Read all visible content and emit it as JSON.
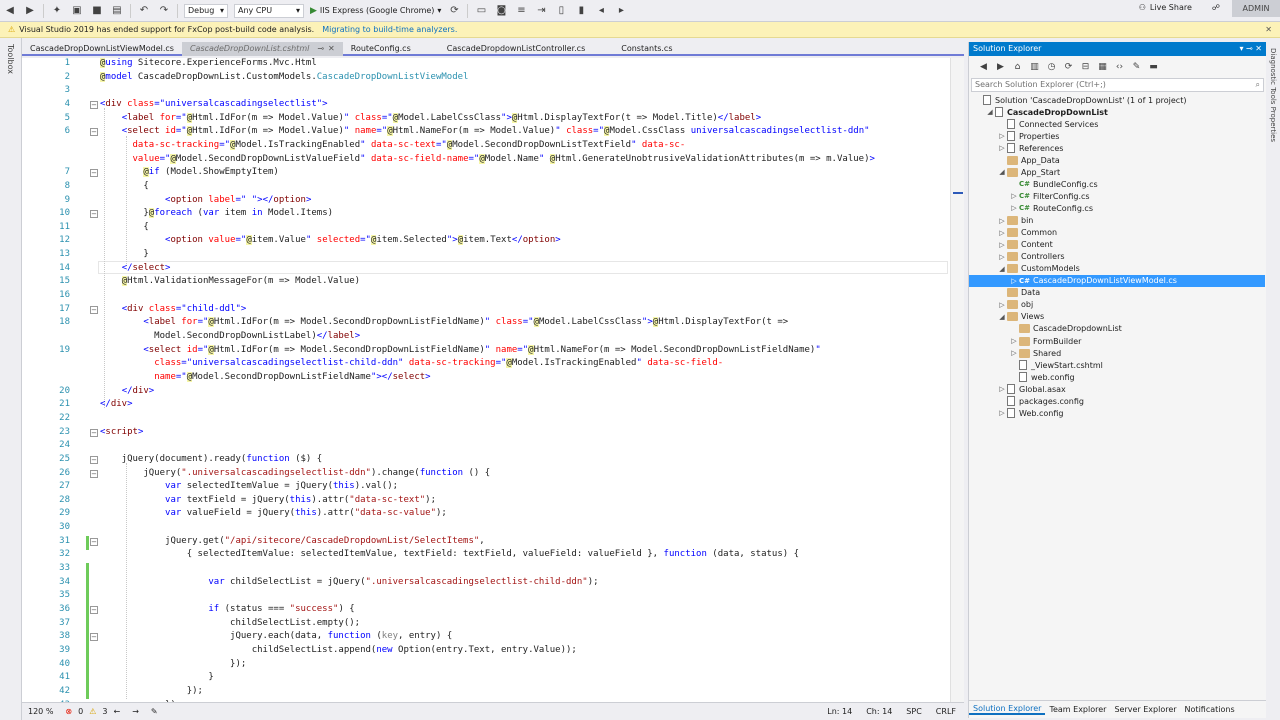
{
  "toolbar": {
    "config": "Debug",
    "platform": "Any CPU",
    "run_target": "IIS Express (Google Chrome)",
    "live_share": "Live Share",
    "user": "ADMIN"
  },
  "infobar": {
    "message": "Visual Studio 2019 has ended support for FxCop post-build code analysis.",
    "link": "Migrating to build-time analyzers."
  },
  "left_strip": "Toolbox",
  "tabs": [
    {
      "label": "CascadeDropDownListViewModel.cs"
    },
    {
      "label": "CascadeDropDownList.cshtml"
    },
    {
      "label": "RouteConfig.cs"
    },
    {
      "label": "CascadeDropdownListController.cs"
    },
    {
      "label": "Constants.cs"
    }
  ],
  "code_lines": [
    {
      "n": "1",
      "html": "<span class='at'>@</span><span class='k'>using</span> Sitecore.ExperienceForms.Mvc.Html"
    },
    {
      "n": "2",
      "html": "<span class='at'>@</span><span class='k'>model</span> CascadeDropDownList.CustomModels.<span class='t'>CascadeDropDownListViewModel</span>"
    },
    {
      "n": "3",
      "html": ""
    },
    {
      "n": "4",
      "html": "<span class='k'>&lt;</span><span class='m'>div</span> <span class='r'>class</span><span class='k'>=\"universalcascadingselectlist\"&gt;</span>"
    },
    {
      "n": "5",
      "html": "    <span class='k'>&lt;</span><span class='m'>label</span> <span class='r'>for</span><span class='k'>=\"</span><span class='at'>@</span>Html.IdFor(m =&gt; Model.Value)<span class='k'>\"</span> <span class='r'>class</span><span class='k'>=\"</span><span class='at'>@</span>Model.LabelCssClass<span class='k'>\"&gt;</span><span class='at'>@</span>Html.DisplayTextFor(t =&gt; Model.Title)<span class='k'>&lt;/</span><span class='m'>label</span><span class='k'>&gt;</span>"
    },
    {
      "n": "6",
      "html": "    <span class='k'>&lt;</span><span class='m'>select</span> <span class='r'>id</span><span class='k'>=\"</span><span class='at'>@</span>Html.IdFor(m =&gt; Model.Value)<span class='k'>\"</span> <span class='r'>name</span><span class='k'>=\"</span><span class='at'>@</span>Html.NameFor(m =&gt; Model.Value)<span class='k'>\"</span> <span class='r'>class</span><span class='k'>=\"</span><span class='at'>@</span>Model.CssClass <span class='k'>universalcascadingselectlist-ddn\"</span>"
    },
    {
      "n": "",
      "html": "      <span class='r'>data-sc-tracking</span><span class='k'>=\"</span><span class='at'>@</span>Model.IsTrackingEnabled<span class='k'>\"</span> <span class='r'>data-sc-text</span><span class='k'>=\"</span><span class='at'>@</span>Model.SecondDropDownListTextField<span class='k'>\"</span> <span class='r'>data-sc-</span>"
    },
    {
      "n": "",
      "html": "      <span class='r'>value</span><span class='k'>=\"</span><span class='at'>@</span>Model.SecondDropDownListValueField<span class='k'>\"</span> <span class='r'>data-sc-field-name</span><span class='k'>=\"</span><span class='at'>@</span>Model.Name<span class='k'>\"</span> <span class='at'>@</span>Html.GenerateUnobtrusiveValidationAttributes(m =&gt; m.Value)<span class='k'>&gt;</span>"
    },
    {
      "n": "7",
      "html": "        <span class='at'>@</span><span class='k'>if</span> (Model.ShowEmptyItem)"
    },
    {
      "n": "8",
      "html": "        {"
    },
    {
      "n": "9",
      "html": "            <span class='k'>&lt;</span><span class='m'>option</span> <span class='r'>label</span><span class='k'>=\" \"&gt;&lt;/</span><span class='m'>option</span><span class='k'>&gt;</span>"
    },
    {
      "n": "10",
      "html": "        }<span class='at'>@</span><span class='k'>foreach</span> (<span class='k'>var</span> item <span class='k'>in</span> Model.Items)"
    },
    {
      "n": "11",
      "html": "        {"
    },
    {
      "n": "12",
      "html": "            <span class='k'>&lt;</span><span class='m'>option</span> <span class='r'>value</span><span class='k'>=\"</span><span class='at'>@</span>item.Value<span class='k'>\"</span> <span class='r'>selected</span><span class='k'>=\"</span><span class='at'>@</span>item.Selected<span class='k'>\"&gt;</span><span class='at'>@</span>item.Text<span class='k'>&lt;/</span><span class='m'>option</span><span class='k'>&gt;</span>"
    },
    {
      "n": "13",
      "html": "        }"
    },
    {
      "n": "14",
      "html": "    <span class='k'>&lt;/</span><span class='m'>select</span><span class='k'>&gt;</span>"
    },
    {
      "n": "15",
      "html": "    <span class='at'>@</span>Html.ValidationMessageFor(m =&gt; Model.Value)"
    },
    {
      "n": "16",
      "html": ""
    },
    {
      "n": "17",
      "html": "    <span class='k'>&lt;</span><span class='m'>div</span> <span class='r'>class</span><span class='k'>=\"child-ddl\"&gt;</span>"
    },
    {
      "n": "18",
      "html": "        <span class='k'>&lt;</span><span class='m'>label</span> <span class='r'>for</span><span class='k'>=\"</span><span class='at'>@</span>Html.IdFor(m =&gt; Model.SecondDropDownListFieldName)<span class='k'>\"</span> <span class='r'>class</span><span class='k'>=\"</span><span class='at'>@</span>Model.LabelCssClass<span class='k'>\"&gt;</span><span class='at'>@</span>Html.DisplayTextFor(t =&gt;"
    },
    {
      "n": "",
      "html": "          Model.SecondDropDownListLabel)<span class='k'>&lt;/</span><span class='m'>label</span><span class='k'>&gt;</span>"
    },
    {
      "n": "19",
      "html": "        <span class='k'>&lt;</span><span class='m'>select</span> <span class='r'>id</span><span class='k'>=\"</span><span class='at'>@</span>Html.IdFor(m =&gt; Model.SecondDropDownListFieldName)<span class='k'>\"</span> <span class='r'>name</span><span class='k'>=\"</span><span class='at'>@</span>Html.NameFor(m =&gt; Model.SecondDropDownListFieldName)<span class='k'>\"</span>"
    },
    {
      "n": "",
      "html": "          <span class='r'>class</span><span class='k'>=\"universalcascadingselectlist-child-ddn\"</span> <span class='r'>data-sc-tracking</span><span class='k'>=\"</span><span class='at'>@</span>Model.IsTrackingEnabled<span class='k'>\"</span> <span class='r'>data-sc-field-</span>"
    },
    {
      "n": "",
      "html": "          <span class='r'>name</span><span class='k'>=\"</span><span class='at'>@</span>Model.SecondDropDownListFieldName<span class='k'>\"&gt;&lt;/</span><span class='m'>select</span><span class='k'>&gt;</span>"
    },
    {
      "n": "20",
      "html": "    <span class='k'>&lt;/</span><span class='m'>div</span><span class='k'>&gt;</span>"
    },
    {
      "n": "21",
      "html": "<span class='k'>&lt;/</span><span class='m'>div</span><span class='k'>&gt;</span>"
    },
    {
      "n": "22",
      "html": ""
    },
    {
      "n": "23",
      "html": "<span class='k'>&lt;</span><span class='m'>script</span><span class='k'>&gt;</span>"
    },
    {
      "n": "24",
      "html": ""
    },
    {
      "n": "25",
      "html": "    jQuery(document).ready(<span class='k'>function</span> ($) {"
    },
    {
      "n": "26",
      "html": "        jQuery(<span class='s'>\".universalcascadingselectlist-ddn\"</span>).change(<span class='k'>function</span> () {"
    },
    {
      "n": "27",
      "html": "            <span class='k'>var</span> selectedItemValue = jQuery(<span class='k'>this</span>).val();"
    },
    {
      "n": "28",
      "html": "            <span class='k'>var</span> textField = jQuery(<span class='k'>this</span>).attr(<span class='s'>\"data-sc-text\"</span>);"
    },
    {
      "n": "29",
      "html": "            <span class='k'>var</span> valueField = jQuery(<span class='k'>this</span>).attr(<span class='s'>\"data-sc-value\"</span>);"
    },
    {
      "n": "30",
      "html": ""
    },
    {
      "n": "31",
      "html": "            jQuery.get(<span class='s'>\"/api/sitecore/CascadeDropdownList/SelectItems\"</span>,"
    },
    {
      "n": "32",
      "html": "                { selectedItemValue: selectedItemValue, textField: textField, valueField: valueField }, <span class='k'>function</span> (data, status) {"
    },
    {
      "n": "33",
      "html": ""
    },
    {
      "n": "34",
      "html": "                    <span class='k'>var</span> childSelectList = jQuery(<span class='s'>\".universalcascadingselectlist-child-ddn\"</span>);"
    },
    {
      "n": "35",
      "html": ""
    },
    {
      "n": "36",
      "html": "                    <span class='k'>if</span> (status === <span class='s'>\"success\"</span>) {"
    },
    {
      "n": "37",
      "html": "                        childSelectList.empty();"
    },
    {
      "n": "38",
      "html": "                        jQuery.each(data, <span class='k'>function</span> (<span class='g'>key</span>, entry) {"
    },
    {
      "n": "39",
      "html": "                            childSelectList.append(<span class='k'>new</span> Option(entry.Text, entry.Value));"
    },
    {
      "n": "40",
      "html": "                        });"
    },
    {
      "n": "41",
      "html": "                    }"
    },
    {
      "n": "42",
      "html": "                });"
    },
    {
      "n": "43",
      "html": "            });"
    }
  ],
  "status": {
    "zoom": "120 %",
    "errors": "0",
    "warnings": "3",
    "ln": "Ln: 14",
    "ch": "Ch: 14",
    "spc": "SPC",
    "crlf": "CRLF"
  },
  "solution_explorer": {
    "title": "Solution Explorer",
    "search_placeholder": "Search Solution Explorer (Ctrl+;)",
    "nodes": [
      {
        "label": "Solution 'CascadeDropDownList' (1 of 1 project)",
        "depth": 0,
        "arrow": "",
        "icon": "file"
      },
      {
        "label": "CascadeDropDownList",
        "depth": 1,
        "arrow": "◢",
        "icon": "file",
        "bold": true
      },
      {
        "label": "Connected Services",
        "depth": 2,
        "arrow": "",
        "icon": "file"
      },
      {
        "label": "Properties",
        "depth": 2,
        "arrow": "▷",
        "icon": "file"
      },
      {
        "label": "References",
        "depth": 2,
        "arrow": "▷",
        "icon": "file"
      },
      {
        "label": "App_Data",
        "depth": 2,
        "arrow": "",
        "icon": "folder"
      },
      {
        "label": "App_Start",
        "depth": 2,
        "arrow": "◢",
        "icon": "folder"
      },
      {
        "label": "BundleConfig.cs",
        "depth": 3,
        "arrow": "",
        "icon": "cs"
      },
      {
        "label": "FilterConfig.cs",
        "depth": 3,
        "arrow": "▷",
        "icon": "cs"
      },
      {
        "label": "RouteConfig.cs",
        "depth": 3,
        "arrow": "▷",
        "icon": "cs"
      },
      {
        "label": "bin",
        "depth": 2,
        "arrow": "▷",
        "icon": "folder"
      },
      {
        "label": "Common",
        "depth": 2,
        "arrow": "▷",
        "icon": "folder"
      },
      {
        "label": "Content",
        "depth": 2,
        "arrow": "▷",
        "icon": "folder"
      },
      {
        "label": "Controllers",
        "depth": 2,
        "arrow": "▷",
        "icon": "folder"
      },
      {
        "label": "CustomModels",
        "depth": 2,
        "arrow": "◢",
        "icon": "folder"
      },
      {
        "label": "CascadeDropDownListViewModel.cs",
        "depth": 3,
        "arrow": "▷",
        "icon": "cs",
        "selected": true
      },
      {
        "label": "Data",
        "depth": 2,
        "arrow": "",
        "icon": "folder"
      },
      {
        "label": "obj",
        "depth": 2,
        "arrow": "▷",
        "icon": "folder"
      },
      {
        "label": "Views",
        "depth": 2,
        "arrow": "◢",
        "icon": "folder"
      },
      {
        "label": "CascadeDropdownList",
        "depth": 3,
        "arrow": "",
        "icon": "folder"
      },
      {
        "label": "FormBuilder",
        "depth": 3,
        "arrow": "▷",
        "icon": "folder"
      },
      {
        "label": "Shared",
        "depth": 3,
        "arrow": "▷",
        "icon": "folder"
      },
      {
        "label": "_ViewStart.cshtml",
        "depth": 3,
        "arrow": "",
        "icon": "file"
      },
      {
        "label": "web.config",
        "depth": 3,
        "arrow": "",
        "icon": "file"
      },
      {
        "label": "Global.asax",
        "depth": 2,
        "arrow": "▷",
        "icon": "file"
      },
      {
        "label": "packages.config",
        "depth": 2,
        "arrow": "",
        "icon": "file"
      },
      {
        "label": "Web.config",
        "depth": 2,
        "arrow": "▷",
        "icon": "file"
      }
    ],
    "bottom_tabs": [
      "Solution Explorer",
      "Team Explorer",
      "Server Explorer",
      "Notifications"
    ]
  },
  "right_strip": "Diagnostic Tools   Properties"
}
